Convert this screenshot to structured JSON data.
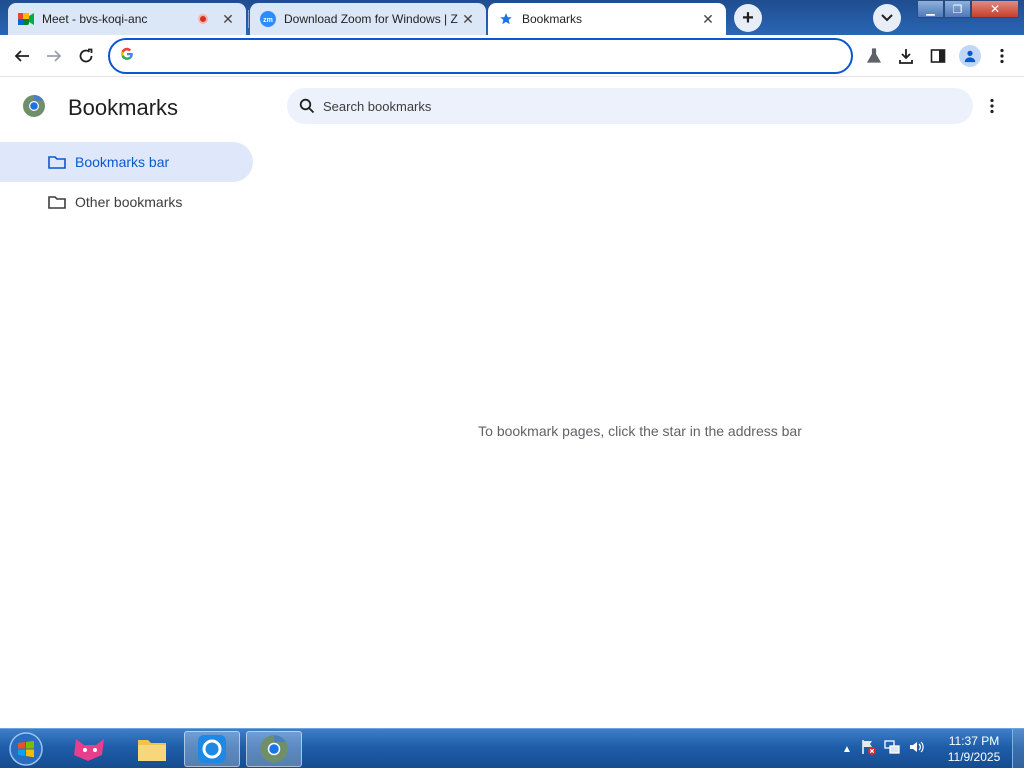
{
  "browser": {
    "tabs": [
      {
        "title": "Meet - bvs-koqi-anc",
        "icon": "google-meet-icon",
        "recording": true,
        "active": false
      },
      {
        "title": "Download Zoom for Windows | Z",
        "icon": "zoom-icon",
        "active": false
      },
      {
        "title": "Bookmarks",
        "icon": "star-icon",
        "active": true
      }
    ],
    "omnibox": {
      "value": "",
      "placeholder": ""
    }
  },
  "bookmarks_page": {
    "title": "Bookmarks",
    "search_placeholder": "Search bookmarks",
    "sidebar": [
      {
        "label": "Bookmarks bar",
        "selected": true
      },
      {
        "label": "Other bookmarks",
        "selected": false
      }
    ],
    "empty_message": "To bookmark pages, click the star in the address bar"
  },
  "taskbar": {
    "time": "11:37 PM",
    "date": "11/9/2025"
  },
  "colors": {
    "accent": "#0b57d0",
    "selected_bg": "#dfe8fb",
    "tabstrip": "#2a66b5"
  }
}
